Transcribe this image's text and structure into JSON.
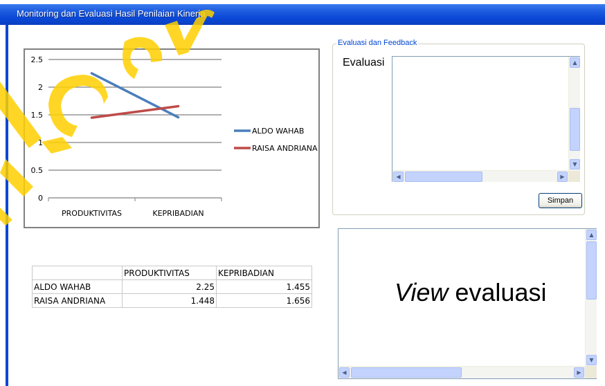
{
  "window": {
    "title": "Monitoring dan Evaluasi Hasil Penilaian Kinerja"
  },
  "chart_data": {
    "type": "line",
    "categories": [
      "PRODUKTIVITAS",
      "KEPRIBADIAN"
    ],
    "series": [
      {
        "name": "ALDO WAHAB",
        "values": [
          2.25,
          1.455
        ],
        "color": "#4a7ebb"
      },
      {
        "name": "RAISA ANDRIANA",
        "values": [
          1.448,
          1.656
        ],
        "color": "#be4b48"
      }
    ],
    "y_ticks": [
      "0",
      "0.5",
      "1",
      "1.5",
      "2",
      "2.5"
    ],
    "ylim": [
      0,
      2.5
    ],
    "grid": true,
    "legend_position": "right"
  },
  "table": {
    "headers": [
      "",
      "PRODUKTIVITAS",
      "KEPRIBADIAN"
    ],
    "rows": [
      [
        "ALDO WAHAB",
        "2.25",
        "1.455"
      ],
      [
        "RAISA ANDRIANA",
        "1.448",
        "1.656"
      ]
    ]
  },
  "evaluation": {
    "group_title": "Evaluasi dan Feedback",
    "label": "Evaluasi",
    "value": "",
    "save_label": "Simpan"
  },
  "view": {
    "text_italic": "View",
    "text_rest": " evaluasi"
  },
  "colors": {
    "titlebar": "#0a47d6",
    "accent_blue": "#0046d5",
    "watermark": "#ffd000"
  },
  "icons": {
    "scroll_up": "scroll-up-arrow-icon",
    "scroll_down": "scroll-down-arrow-icon",
    "scroll_left": "scroll-left-arrow-icon",
    "scroll_right": "scroll-right-arrow-icon"
  }
}
